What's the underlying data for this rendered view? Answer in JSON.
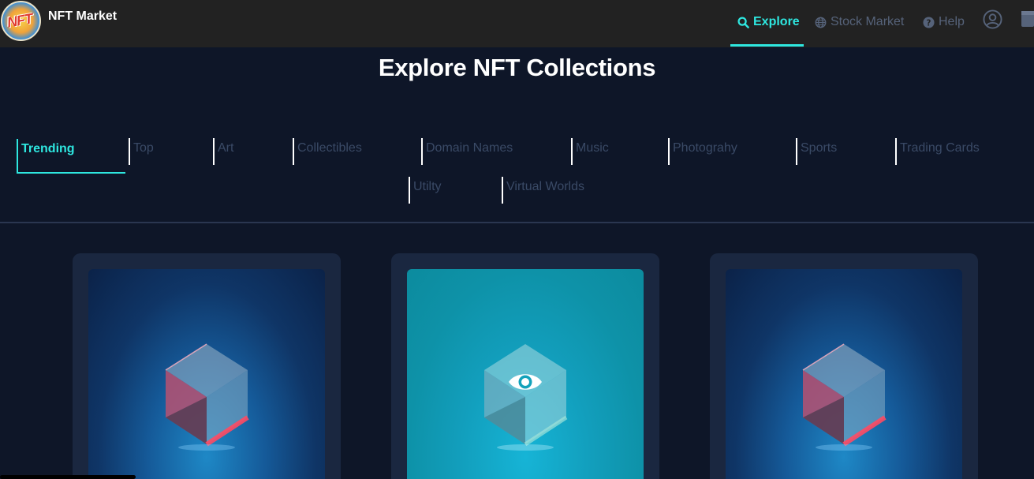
{
  "header": {
    "logo_text": "NFT",
    "brand": "NFT Market",
    "nav": [
      {
        "label": "Explore",
        "icon": "search-icon",
        "active": true
      },
      {
        "label": "Stock Market",
        "icon": "globe-icon",
        "active": false
      },
      {
        "label": "Help",
        "icon": "help-icon",
        "active": false
      }
    ],
    "profile_icon": "user-circle-icon",
    "calendar_icon": "calendar-icon"
  },
  "page": {
    "title": "Explore NFT Collections"
  },
  "tabs": [
    {
      "label": "Trending",
      "active": true
    },
    {
      "label": "Top"
    },
    {
      "label": "Art"
    },
    {
      "label": "Collectibles"
    },
    {
      "label": "Domain Names"
    },
    {
      "label": "Music"
    },
    {
      "label": "Photograhy"
    },
    {
      "label": "Sports"
    },
    {
      "label": "Trading Cards"
    },
    {
      "label": "Utilty"
    },
    {
      "label": "Virtual Worlds"
    }
  ],
  "cards": [
    {
      "image": "glass-cube",
      "hovered": false
    },
    {
      "image": "glass-cube",
      "hovered": true,
      "overlay_icon": "eye-icon"
    },
    {
      "image": "glass-cube",
      "hovered": false
    }
  ],
  "colors": {
    "accent": "#2ee7e0",
    "background": "#0e1628",
    "topbar": "#222222",
    "card": "#1a2740",
    "tab_inactive": "#3a4a66"
  }
}
